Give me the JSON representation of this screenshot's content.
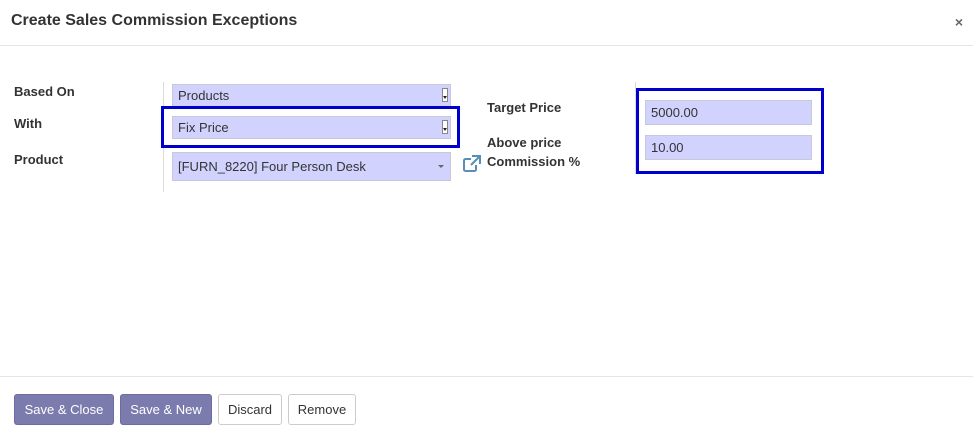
{
  "dialog": {
    "title": "Create Sales Commission Exceptions",
    "close_glyph": "×"
  },
  "form": {
    "based_on": {
      "label": "Based On",
      "value": "Products"
    },
    "with": {
      "label": "With",
      "value": "Fix Price"
    },
    "product": {
      "label": "Product",
      "value": "[FURN_8220] Four Person Desk",
      "icon": "external-link-icon"
    },
    "target_price": {
      "label": "Target Price",
      "value": "5000.00"
    },
    "above_price_commission": {
      "label_line1": "Above price",
      "label_line2": "Commission %",
      "value": "10.00"
    }
  },
  "footer": {
    "save_close": "Save & Close",
    "save_new": "Save & New",
    "discard": "Discard",
    "remove": "Remove"
  },
  "colors": {
    "field_bg": "#d2d2ff",
    "highlight_border": "#0000cc",
    "primary_button": "#7c7bad"
  }
}
